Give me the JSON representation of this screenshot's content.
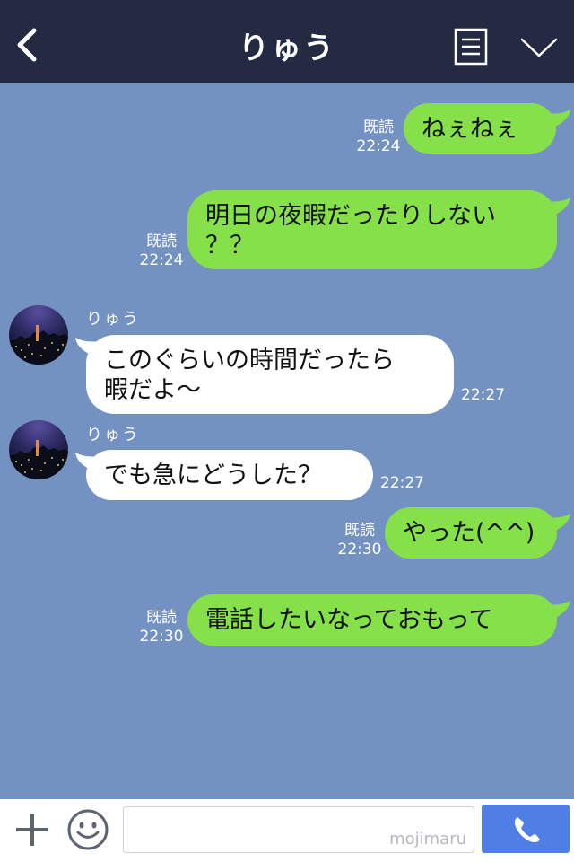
{
  "header": {
    "title": "りゅう",
    "back_icon": "chevron-left-icon",
    "menu_icon": "menu-lines-icon",
    "collapse_icon": "chevron-down-icon",
    "background": "#232a42"
  },
  "chat": {
    "background": "#7392c2",
    "bubble_colors": {
      "outgoing": "#85e049",
      "incoming": "#ffffff"
    },
    "messages": [
      {
        "direction": "outgoing",
        "text": "ねぇねぇ",
        "read": "既読",
        "time": "22:24"
      },
      {
        "direction": "outgoing",
        "text": "明日の夜暇だったりしない\n？？",
        "read": "既読",
        "time": "22:24"
      },
      {
        "direction": "incoming",
        "sender": "りゅう",
        "text": "このぐらいの時間だったら\n暇だよ〜",
        "time": "22:27"
      },
      {
        "direction": "incoming",
        "sender": "りゅう",
        "text": "でも急にどうした？",
        "time": "22:27"
      },
      {
        "direction": "outgoing",
        "text": "やった(^^)",
        "read": "既読",
        "time": "22:30"
      },
      {
        "direction": "outgoing",
        "text": "電話したいなっておもって",
        "read": "既読",
        "time": "22:30"
      }
    ]
  },
  "bottom_bar": {
    "plus_icon": "plus-icon",
    "emoji_icon": "smiley-icon",
    "input_value": "",
    "watermark": "mojimaru",
    "call_icon": "phone-icon",
    "call_color": "#4f7fe4"
  }
}
